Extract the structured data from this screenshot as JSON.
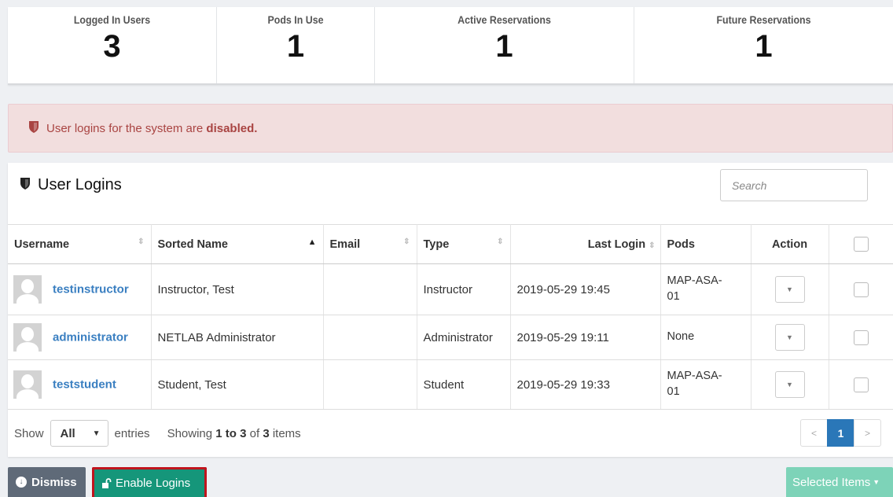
{
  "stats": [
    {
      "label": "Logged In Users",
      "value": "3"
    },
    {
      "label": "Pods In Use",
      "value": "1"
    },
    {
      "label": "Active Reservations",
      "value": "1"
    },
    {
      "label": "Future Reservations",
      "value": "1"
    }
  ],
  "alert": {
    "icon": "shield-icon",
    "text_before": "User logins for the system are ",
    "text_bold": "disabled.",
    "color": "#a94442",
    "bg": "#f2dede"
  },
  "panel": {
    "title": "User Logins",
    "search_placeholder": "Search"
  },
  "table": {
    "columns": [
      "Username",
      "Sorted Name",
      "Email",
      "Type",
      "Last Login",
      "Pods",
      "Action"
    ],
    "rows": [
      {
        "username": "testinstructor",
        "sorted_name": "Instructor, Test",
        "email": "",
        "type": "Instructor",
        "last_login": "2019-05-29 19:45",
        "pods_l1": "MAP-ASA-",
        "pods_l2": "01"
      },
      {
        "username": "administrator",
        "sorted_name": "NETLAB Administrator",
        "email": "",
        "type": "Administrator",
        "last_login": "2019-05-29 19:11",
        "pods_l1": "None",
        "pods_l2": ""
      },
      {
        "username": "teststudent",
        "sorted_name": "Student, Test",
        "email": "",
        "type": "Student",
        "last_login": "2019-05-29 19:33",
        "pods_l1": "MAP-ASA-",
        "pods_l2": "01"
      }
    ]
  },
  "footer": {
    "show_label": "Show",
    "length_value": "All",
    "entries_label": "entries",
    "showing_label": "Showing",
    "range": "1 to 3",
    "of_label": "of",
    "total": "3",
    "items_label": "items",
    "pager": {
      "prev": "<",
      "current": "1",
      "next": ">"
    }
  },
  "buttons": {
    "dismiss": "Dismiss",
    "enable_logins": "Enable Logins",
    "selected_items": "Selected Items"
  },
  "colors": {
    "accent_blue": "#2a77b8",
    "link": "#3a7fc1",
    "enable_green": "#15967a",
    "highlight_red": "#c0141d"
  }
}
